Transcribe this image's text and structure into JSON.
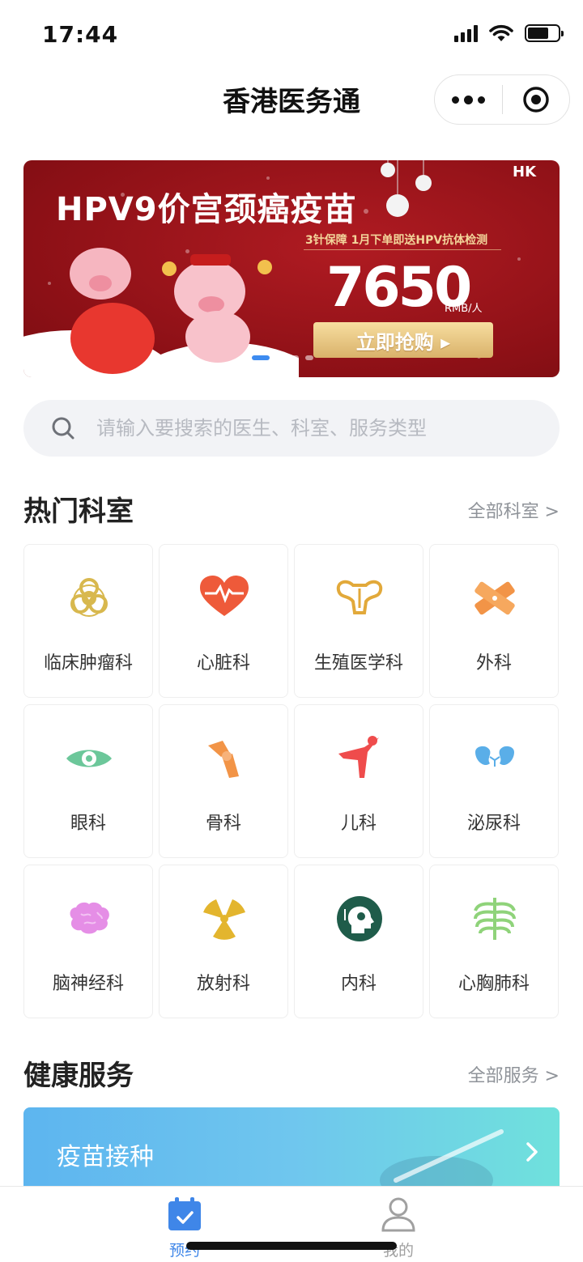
{
  "status_bar": {
    "time": "17:44"
  },
  "nav": {
    "title": "香港医务通"
  },
  "banner": {
    "title": "HPV9价宫颈癌疫苗",
    "subtitle": "3针保障  1月下单即送HPV抗体检测",
    "price": "7650",
    "unit": "RMB/人",
    "cta": "立即抢购 ▸",
    "logo": "HK",
    "slides": 4,
    "active_slide": 1
  },
  "search": {
    "placeholder": "请输入要搜索的医生、科室、服务类型"
  },
  "hot_departments": {
    "title": "热门科室",
    "link": "全部科室 >",
    "items": [
      {
        "label": "临床肿瘤科",
        "icon": "biohazard-icon",
        "color": "#d8b84e"
      },
      {
        "label": "心脏科",
        "icon": "heart-icon",
        "color": "#ee5a3a"
      },
      {
        "label": "生殖医学科",
        "icon": "uterus-icon",
        "color": "#e2a93a"
      },
      {
        "label": "外科",
        "icon": "bandage-icon",
        "color": "#f29447"
      },
      {
        "label": "眼科",
        "icon": "eye-icon",
        "color": "#6cc79a"
      },
      {
        "label": "骨科",
        "icon": "bone-joint-icon",
        "color": "#f29447"
      },
      {
        "label": "儿科",
        "icon": "child-icon",
        "color": "#ef4c4c"
      },
      {
        "label": "泌尿科",
        "icon": "kidney-icon",
        "color": "#5aaee8"
      },
      {
        "label": "脑神经科",
        "icon": "brain-icon",
        "color": "#e58ee6"
      },
      {
        "label": "放射科",
        "icon": "radiation-icon",
        "color": "#e3b52e"
      },
      {
        "label": "内科",
        "icon": "head-medical-icon",
        "color": "#1f5c4a"
      },
      {
        "label": "心胸肺科",
        "icon": "ribcage-icon",
        "color": "#8fd37a"
      }
    ]
  },
  "health_services": {
    "title": "健康服务",
    "link": "全部服务 >",
    "items": [
      {
        "label": "疫苗接种"
      }
    ]
  },
  "tab_bar": {
    "tabs": [
      {
        "label": "预约",
        "icon": "calendar-icon",
        "active": true
      },
      {
        "label": "我的",
        "icon": "user-icon",
        "active": false
      }
    ],
    "active_color": "#3f86e8",
    "inactive_color": "#a0a0a0"
  }
}
